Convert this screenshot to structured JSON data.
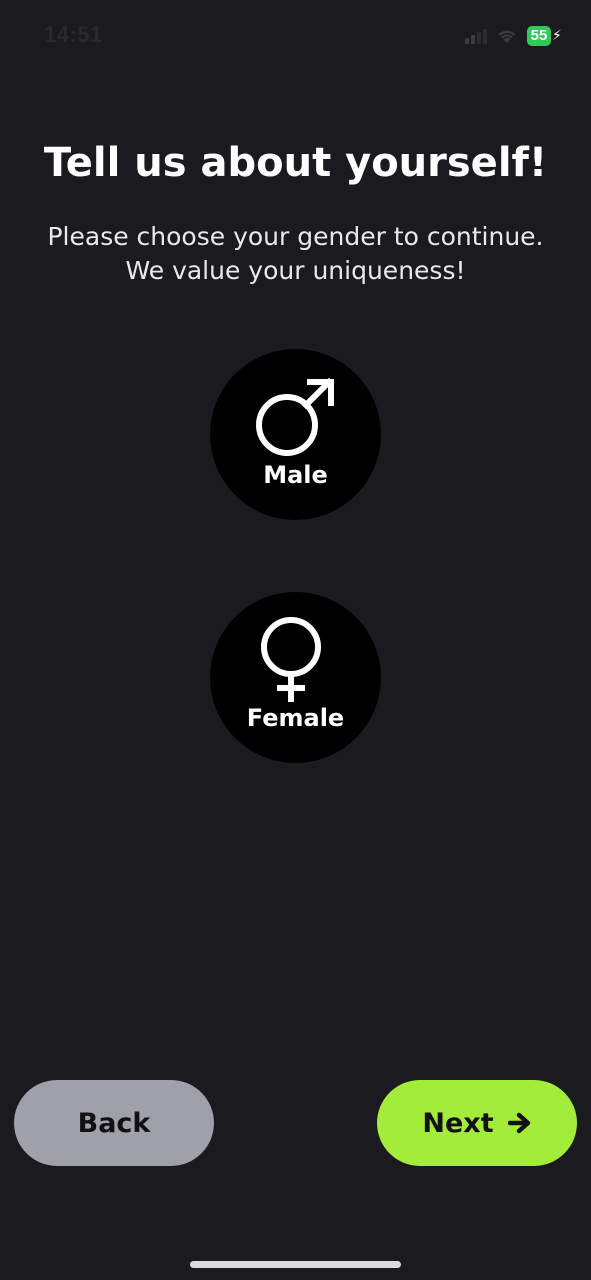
{
  "status_bar": {
    "time": "14:51",
    "battery_level": "55",
    "icons": [
      "cellular-signal-icon",
      "wifi-icon",
      "battery-icon",
      "charging-bolt-icon"
    ]
  },
  "header": {
    "title": "Tell us about yourself!",
    "subtitle": "Please choose your gender to continue. We value your uniqueness!"
  },
  "gender_options": [
    {
      "label": "Male",
      "icon": "male-symbol-icon"
    },
    {
      "label": "Female",
      "icon": "female-symbol-icon"
    }
  ],
  "footer": {
    "back_label": "Back",
    "next_label": "Next",
    "next_icon": "arrow-right-icon"
  },
  "colors": {
    "background": "#1b1a1f",
    "option_circle": "#000000",
    "back_button": "#a0a0ab",
    "next_button": "#a3ed3a",
    "battery": "#34c759"
  }
}
